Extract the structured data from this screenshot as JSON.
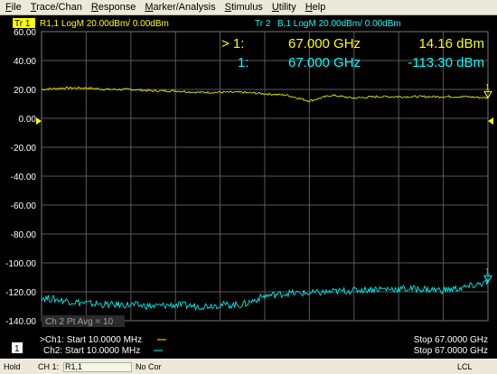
{
  "menu": [
    "File",
    "Trace/Chan",
    "Response",
    "Marker/Analysis",
    "Stimulus",
    "Utility",
    "Help"
  ],
  "trace1": {
    "tag": "Tr 1",
    "info": "R1,1 LogM 20.00dBm/  0.00dBm",
    "color": "#ffff00"
  },
  "trace2": {
    "tag": "Tr 2",
    "info": "B,1 LogM 20.00dBm/  0.00dBm",
    "color": "#00ffff"
  },
  "markers": [
    {
      "label": "> 1:",
      "freq": "67.000 GHz",
      "value": "14.16 dBm",
      "color": "#ffff00"
    },
    {
      "label": "1:",
      "freq": "67.000 GHz",
      "value": "-113.30 dBm",
      "color": "#00ffff"
    }
  ],
  "y_ticks": [
    "60.00",
    "40.00",
    "20.00",
    "0.00",
    "-20.00",
    "-40.00",
    "-60.00",
    "-80.00",
    "-100.00",
    "-120.00",
    "-140.00"
  ],
  "avg_text": "Ch 2 Pt Avg = 10",
  "window_number": "1",
  "footer": {
    "ch1_start": ">Ch1: Start  10.0000 MHz",
    "ch2_start": "Ch2: Start  10.0000 MHz",
    "ch1_stop": "Stop  67.0000 GHz",
    "ch2_stop": "Stop  67.0000 GHz"
  },
  "status": {
    "hold": "Hold",
    "channel": "CH 1:",
    "param": "R1,1",
    "correction": "No Cor",
    "lcl": "LCL"
  },
  "chart_data": {
    "type": "line",
    "xlabel": "",
    "ylabel": "",
    "x_range_text": [
      "10.0000 MHz",
      "67.0000 GHz"
    ],
    "ylim": [
      -140,
      60
    ],
    "grid": true,
    "reference_level": 0,
    "series": [
      {
        "name": "Tr 1",
        "color": "#ffff00",
        "x": [
          0,
          5,
          10,
          15,
          20,
          25,
          30,
          35,
          40,
          45,
          50,
          55,
          60,
          65,
          70,
          75,
          80,
          85,
          90,
          95,
          100
        ],
        "values": [
          20,
          21,
          21,
          20,
          20,
          19,
          19,
          18,
          18,
          18,
          17,
          16,
          12,
          16,
          14,
          15,
          15,
          15,
          15,
          15,
          14.16
        ]
      },
      {
        "name": "Tr 2",
        "color": "#00ffff",
        "x": [
          0,
          5,
          10,
          15,
          20,
          25,
          30,
          35,
          40,
          45,
          50,
          55,
          60,
          65,
          70,
          75,
          80,
          85,
          90,
          95,
          100
        ],
        "values": [
          -124,
          -126,
          -128,
          -129,
          -129,
          -130,
          -129,
          -130,
          -129,
          -129,
          -123,
          -121,
          -121,
          -120,
          -119,
          -118,
          -118,
          -118,
          -119,
          -117,
          -113.3
        ]
      }
    ]
  }
}
